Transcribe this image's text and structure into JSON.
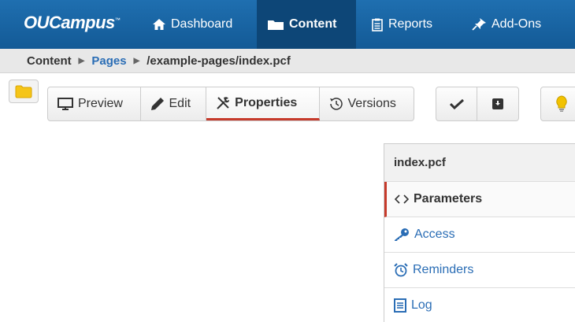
{
  "app": {
    "logo_prefix": "OU",
    "logo_suffix": "Campus",
    "logo_tm": "™"
  },
  "nav": {
    "items": [
      {
        "label": "Dashboard",
        "icon": "home-icon"
      },
      {
        "label": "Content",
        "icon": "folder-icon",
        "active": true
      },
      {
        "label": "Reports",
        "icon": "clipboard-icon"
      },
      {
        "label": "Add-Ons",
        "icon": "pin-icon"
      }
    ]
  },
  "breadcrumb": {
    "items": [
      "Content",
      "Pages",
      "/example-pages/index.pcf"
    ]
  },
  "toolbar": {
    "buttons": [
      {
        "label": "Preview",
        "icon": "monitor-icon"
      },
      {
        "label": "Edit",
        "icon": "pencil-icon"
      },
      {
        "label": "Properties",
        "icon": "tools-icon",
        "active": true
      },
      {
        "label": "Versions",
        "icon": "history-icon"
      }
    ],
    "action_icons": [
      "checkmark-icon",
      "archive-icon",
      "lightbulb-icon"
    ]
  },
  "panel": {
    "title": "index.pcf",
    "items": [
      {
        "label": "Parameters",
        "icon": "code-icon",
        "active": true
      },
      {
        "label": "Access",
        "icon": "key-icon"
      },
      {
        "label": "Reminders",
        "icon": "alarm-icon"
      },
      {
        "label": "Log",
        "icon": "list-icon"
      }
    ]
  },
  "colors": {
    "nav_bg": "#1a65a6",
    "nav_active": "#0d4677",
    "link": "#2a6db5",
    "accent_red": "#c63a2b",
    "folder_yellow": "#f5c518",
    "bulb_yellow": "#f2c200"
  }
}
